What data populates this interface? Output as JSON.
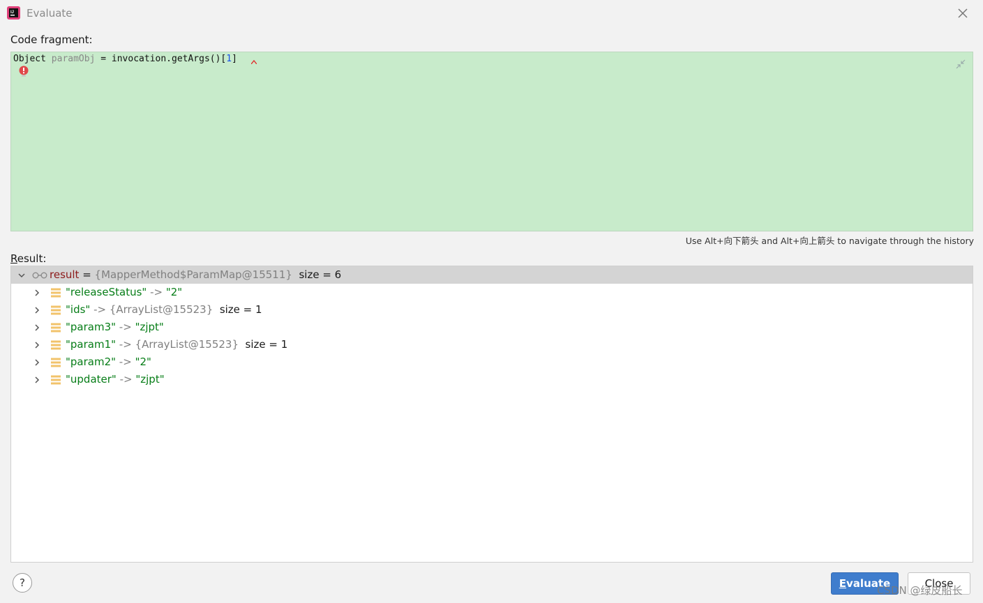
{
  "window": {
    "title": "Evaluate"
  },
  "code": {
    "label": "Code fragment:",
    "tokens": {
      "type": "Object ",
      "var": "paramObj",
      "mid": " = invocation.getArgs()[",
      "num": "1",
      "end": "]"
    }
  },
  "hint": "Use Alt+向下箭头 and Alt+向上箭头 to navigate through the history",
  "result": {
    "label_mnemonic": "R",
    "label_rest": "esult:",
    "root": {
      "name": "result",
      "eq": " = ",
      "value": "{MapperMethod$ParamMap@15511}",
      "size": "size = 6"
    },
    "entries": [
      {
        "key": "\"releaseStatus\"",
        "arrow": " -> ",
        "value": "\"2\"",
        "value_is_string": true,
        "size": ""
      },
      {
        "key": "\"ids\"",
        "arrow": " -> ",
        "value": "{ArrayList@15523}",
        "value_is_string": false,
        "size": "size = 1"
      },
      {
        "key": "\"param3\"",
        "arrow": " -> ",
        "value": "\"zjpt\"",
        "value_is_string": true,
        "size": ""
      },
      {
        "key": "\"param1\"",
        "arrow": " -> ",
        "value": "{ArrayList@15523}",
        "value_is_string": false,
        "size": "size = 1"
      },
      {
        "key": "\"param2\"",
        "arrow": " -> ",
        "value": "\"2\"",
        "value_is_string": true,
        "size": ""
      },
      {
        "key": "\"updater\"",
        "arrow": " -> ",
        "value": "\"zjpt\"",
        "value_is_string": true,
        "size": ""
      }
    ]
  },
  "buttons": {
    "help": "?",
    "evaluate_mnemonic": "E",
    "evaluate_rest": "valuate",
    "close": "Close"
  },
  "watermark": "CSDN @绿皮船长",
  "colors": {
    "editor_bg": "#c8ebcb",
    "string": "#067d17",
    "selection": "#d4d4d4",
    "primary_button": "#3f7dcd"
  }
}
